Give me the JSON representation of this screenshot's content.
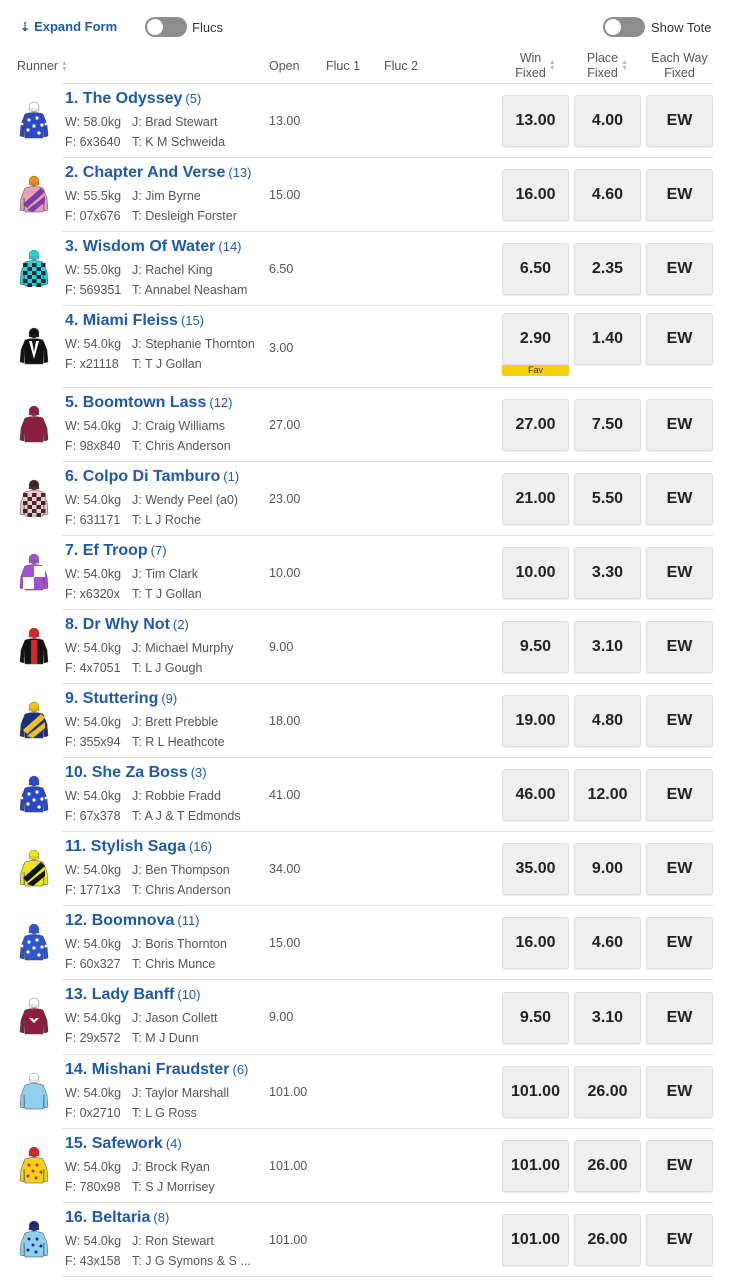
{
  "toolbar": {
    "expand_label": "Expand Form",
    "flucs_label": "Flucs",
    "show_tote_label": "Show Tote"
  },
  "header": {
    "runner": "Runner",
    "open": "Open",
    "fluc1": "Fluc 1",
    "fluc2": "Fluc 2",
    "win_line1": "Win",
    "win_line2": "Fixed",
    "place_line1": "Place",
    "place_line2": "Fixed",
    "ew_line1": "Each Way",
    "ew_line2": "Fixed"
  },
  "runners": [
    {
      "name": "1. The Odyssey",
      "barrier": "(5)",
      "weight": "W: 58.0kg",
      "jockey": "J: Brad Stewart",
      "form": "F: 6x3640",
      "trainer": "T: K M Schweida",
      "open": "13.00",
      "win": "13.00",
      "place": "4.00",
      "ew": "EW",
      "fav": "",
      "silk": {
        "body": "#2b48c8",
        "accent": "#ffffff",
        "cap": "#ffffff",
        "pattern": "stars"
      }
    },
    {
      "name": "2. Chapter And Verse",
      "barrier": "(13)",
      "weight": "W: 55.5kg",
      "jockey": "J: Jim Byrne",
      "form": "F: 07x676",
      "trainer": "T: Desleigh Forster",
      "open": "15.00",
      "win": "16.00",
      "place": "4.60",
      "ew": "EW",
      "fav": "",
      "silk": {
        "body": "#e8a0b8",
        "accent": "#7a3fa0",
        "cap": "#f08a1a",
        "pattern": "diagonal"
      }
    },
    {
      "name": "3. Wisdom Of Water",
      "barrier": "(14)",
      "weight": "W: 55.0kg",
      "jockey": "J: Rachel King",
      "form": "F: 569351",
      "trainer": "T: Annabel Neasham",
      "open": "6.50",
      "win": "6.50",
      "place": "2.35",
      "ew": "EW",
      "fav": "",
      "silk": {
        "body": "#27d2d2",
        "accent": "#0a2a3a",
        "cap": "#27d2d2",
        "pattern": "checks"
      }
    },
    {
      "name": "4. Miami Fleiss",
      "barrier": "(15)",
      "weight": "W: 54.0kg",
      "jockey": "J: Stephanie Thornton",
      "form": "F: x21118",
      "trainer": "T: T J Gollan",
      "open": "3.00",
      "win": "2.90",
      "place": "1.40",
      "ew": "EW",
      "fav": "Fav",
      "silk": {
        "body": "#111111",
        "accent": "#ffffff",
        "cap": "#111111",
        "pattern": "vee"
      }
    },
    {
      "name": "5. Boomtown Lass",
      "barrier": "(12)",
      "weight": "W: 54.0kg",
      "jockey": "J: Craig Williams",
      "form": "F: 98x840",
      "trainer": "T: Chris Anderson",
      "open": "27.00",
      "win": "27.00",
      "place": "7.50",
      "ew": "EW",
      "fav": "",
      "silk": {
        "body": "#8b1e3f",
        "accent": "#8b1e3f",
        "cap": "#8b1e3f",
        "pattern": "plain"
      }
    },
    {
      "name": "6. Colpo Di Tamburo",
      "barrier": "(1)",
      "weight": "W: 54.0kg",
      "jockey": "J: Wendy Peel (a0)",
      "form": "F: 631171",
      "trainer": "T: L J Roche",
      "open": "23.00",
      "win": "21.00",
      "place": "5.50",
      "ew": "EW",
      "fav": "",
      "silk": {
        "body": "#f2c6cf",
        "accent": "#3a2a2a",
        "cap": "#3a2a2a",
        "pattern": "checks"
      }
    },
    {
      "name": "7. Ef Troop",
      "barrier": "(7)",
      "weight": "W: 54.0kg",
      "jockey": "J: Tim Clark",
      "form": "F: x6320x",
      "trainer": "T: T J Gollan",
      "open": "10.00",
      "win": "10.00",
      "place": "3.30",
      "ew": "EW",
      "fav": "",
      "silk": {
        "body": "#a24fd0",
        "accent": "#ffffff",
        "cap": "#a24fd0",
        "pattern": "quarters"
      }
    },
    {
      "name": "8. Dr Why Not",
      "barrier": "(2)",
      "weight": "W: 54.0kg",
      "jockey": "J: Michael Murphy",
      "form": "F: 4x7051",
      "trainer": "T: L J Gough",
      "open": "9.00",
      "win": "9.50",
      "place": "3.10",
      "ew": "EW",
      "fav": "",
      "silk": {
        "body": "#111111",
        "accent": "#d8252a",
        "cap": "#d8252a",
        "pattern": "stripe"
      }
    },
    {
      "name": "9. Stuttering",
      "barrier": "(9)",
      "weight": "W: 54.0kg",
      "jockey": "J: Brett Prebble",
      "form": "F: 355x94",
      "trainer": "T: R L Heathcote",
      "open": "18.00",
      "win": "19.00",
      "place": "4.80",
      "ew": "EW",
      "fav": "",
      "silk": {
        "body": "#1a2f7a",
        "accent": "#f3c21a",
        "cap": "#f3c21a",
        "pattern": "diagonal"
      }
    },
    {
      "name": "10. She Za Boss",
      "barrier": "(3)",
      "weight": "W: 54.0kg",
      "jockey": "J: Robbie Fradd",
      "form": "F: 67x378",
      "trainer": "T: A J & T Edmonds",
      "open": "41.00",
      "win": "46.00",
      "place": "12.00",
      "ew": "EW",
      "fav": "",
      "silk": {
        "body": "#2b48c8",
        "accent": "#ffffff",
        "cap": "#2b48c8",
        "pattern": "stars"
      }
    },
    {
      "name": "11. Stylish Saga",
      "barrier": "(16)",
      "weight": "W: 54.0kg",
      "jockey": "J: Ben Thompson",
      "form": "F: 1771x3",
      "trainer": "T: Chris Anderson",
      "open": "34.00",
      "win": "35.00",
      "place": "9.00",
      "ew": "EW",
      "fav": "",
      "silk": {
        "body": "#f0e51a",
        "accent": "#111111",
        "cap": "#f0e51a",
        "pattern": "diagonal"
      }
    },
    {
      "name": "12. Boomnova",
      "barrier": "(11)",
      "weight": "W: 54.0kg",
      "jockey": "J: Boris Thornton",
      "form": "F: 60x327",
      "trainer": "T: Chris Munce",
      "open": "15.00",
      "win": "16.00",
      "place": "4.60",
      "ew": "EW",
      "fav": "",
      "silk": {
        "body": "#2f55d0",
        "accent": "#ffffff",
        "cap": "#2f55d0",
        "pattern": "stars"
      }
    },
    {
      "name": "13. Lady Banff",
      "barrier": "(10)",
      "weight": "W: 54.0kg",
      "jockey": "J: Jason Collett",
      "form": "F: 29x572",
      "trainer": "T: M J Dunn",
      "open": "9.00",
      "win": "9.50",
      "place": "3.10",
      "ew": "EW",
      "fav": "",
      "silk": {
        "body": "#8b1e3f",
        "accent": "#ffffff",
        "cap": "#ffffff",
        "pattern": "emblem"
      }
    },
    {
      "name": "14. Mishani Fraudster",
      "barrier": "(6)",
      "weight": "W: 54.0kg",
      "jockey": "J: Taylor Marshall",
      "form": "F: 0x2710",
      "trainer": "T: L G Ross",
      "open": "101.00",
      "win": "101.00",
      "place": "26.00",
      "ew": "EW",
      "fav": "",
      "silk": {
        "body": "#8fd0ee",
        "accent": "#8fd0ee",
        "cap": "#ffffff",
        "pattern": "plain"
      }
    },
    {
      "name": "15. Safework",
      "barrier": "(4)",
      "weight": "W: 54.0kg",
      "jockey": "J: Brock Ryan",
      "form": "F: 780x98",
      "trainer": "T: S J Morrisey",
      "open": "101.00",
      "win": "101.00",
      "place": "26.00",
      "ew": "EW",
      "fav": "",
      "silk": {
        "body": "#f3d21a",
        "accent": "#d8252a",
        "cap": "#d8252a",
        "pattern": "spots"
      }
    },
    {
      "name": "16. Beltaria",
      "barrier": "(8)",
      "weight": "W: 54.0kg",
      "jockey": "J: Ron Stewart",
      "form": "F: 43x158",
      "trainer": "T: J G Symons & S ...",
      "open": "101.00",
      "win": "101.00",
      "place": "26.00",
      "ew": "EW",
      "fav": "",
      "silk": {
        "body": "#8fd0ee",
        "accent": "#1a2f7a",
        "cap": "#1a2f7a",
        "pattern": "spots"
      }
    }
  ]
}
